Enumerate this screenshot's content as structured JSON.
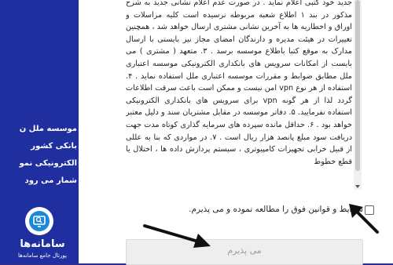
{
  "left_panel": {
    "lines": [
      "موسسه ملل ن",
      "بانکی کشور",
      "الکترونیکی نمو",
      "شمار می رود"
    ]
  },
  "terms": {
    "paragraph": "جدید خود کتبی اعلام نماید . در صورت عدم اعلام نشانی جدید به شرح مذکور در بند ۱ اطلاع شعبه مربوطه نرسیده است کلیه مراسلات و اوراق و اخطاریه ها به آخرین نشانی مشتری ارسال خواهد شد ، همچنین تغییرات در هیئت مدیره و دارندگان امضای مجاز نیز بایستی با ارسال مدارک به موقع کتبا باطلاع موسسه برسد . ۳. متعهد ( مشتری ) می بایست از امکانات سرویس های بانکداری الکترونیکی موسسه اعتباری ملل مطابق ضوابط و مقررات موسسه اعتباری ملل استفاده نماید . ۴. استفاده از هر نوع vpn امن نیست و ممکن است باعث سرقت اطلاعات گردد لذا از هر گونه vpn برای سرویس های بانکداری الکترونیکی استفاده نفرمایید. ۵. دفاتر موسسه در مقابل مشتریان سند و دلیل معتبر خواهد بود . ۶. حداقل مانده سپرده های سرمایه گذاری کوتاه مدت جهت دریافت سود مبلغ پانصد هزار ریال است . ۷. در مواردی که بنا به عللی از قبیل خرابی تجهیزات کامپیوتری ، سیستم پردازش داده ها ، اختلال یا قطع خطوط"
  },
  "agreement": {
    "label": "شرایط و قوانین فوق را مطالعه نموده و می پذیرم."
  },
  "accept_button": {
    "label": "می پذیرم"
  },
  "logo": {
    "name": "سامانه‌ها",
    "tagline": "پورتال جامع سامانه‌ها"
  },
  "colors": {
    "panel": "#1f2fa0",
    "logo_accent": "#1e88d8",
    "arrow": "#111111"
  }
}
